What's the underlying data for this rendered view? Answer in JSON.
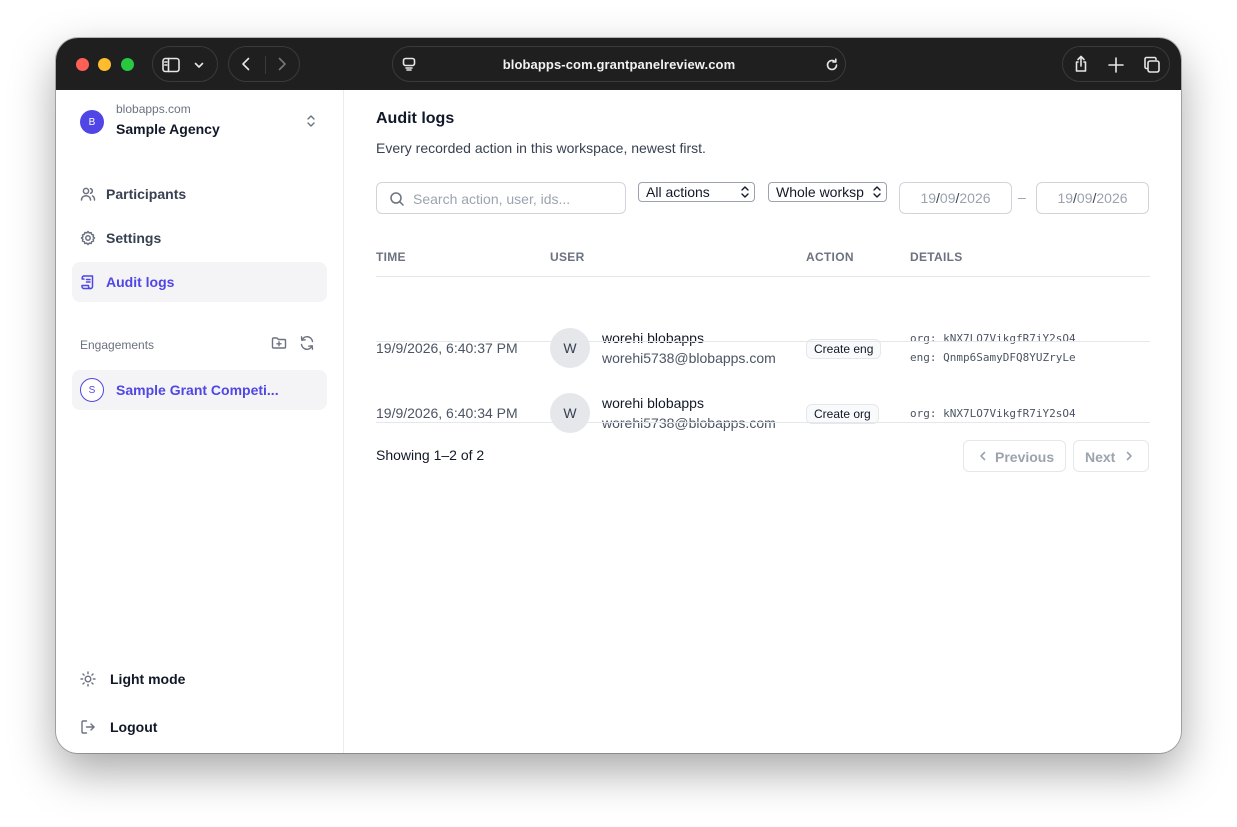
{
  "browser": {
    "url": "blobapps-com.grantpanelreview.com"
  },
  "sidebar": {
    "org": {
      "avatar_letter": "B",
      "domain": "blobapps.com",
      "name": "Sample Agency"
    },
    "nav": [
      {
        "label": "Participants",
        "icon": "users-icon",
        "active": false
      },
      {
        "label": "Settings",
        "icon": "gear-icon",
        "active": false
      },
      {
        "label": "Audit logs",
        "icon": "scroll-icon",
        "active": true
      }
    ],
    "engagements_label": "Engagements",
    "engagements": [
      {
        "avatar_letter": "S",
        "label": "Sample Grant Competi..."
      }
    ],
    "light_mode_label": "Light mode",
    "logout_label": "Logout"
  },
  "main": {
    "title": "Audit logs",
    "subtitle": "Every recorded action in this workspace, newest first.",
    "search_placeholder": "Search action, user, ids...",
    "action_filter": "All actions",
    "scope_filter": "Whole worksp",
    "date_from": {
      "day": "19",
      "month": "09",
      "year": "2026"
    },
    "date_sep": "–",
    "date_to": {
      "day": "19",
      "month": "09",
      "year": "2026"
    },
    "columns": [
      "TIME",
      "USER",
      "ACTION",
      "DETAILS"
    ],
    "rows": [
      {
        "time": "19/9/2026, 6:40:37 PM",
        "avatar_letter": "W",
        "user_name": "worehi blobapps",
        "user_email": "worehi5738@blobapps.com",
        "action": "Create eng",
        "details": [
          "org: kNX7LO7VikgfR7iY2sO4",
          "eng: Qnmp6SamyDFQ8YUZryLe"
        ]
      },
      {
        "time": "19/9/2026, 6:40:34 PM",
        "avatar_letter": "W",
        "user_name": "worehi blobapps",
        "user_email": "worehi5738@blobapps.com",
        "action": "Create org",
        "details": [
          "org: kNX7LO7VikgfR7iY2sO4"
        ]
      }
    ],
    "showing": "Showing 1–2 of 2",
    "prev_label": "Previous",
    "next_label": "Next"
  },
  "colors": {
    "accent": "#4f46e5",
    "titlebar": "#1f1f1f"
  }
}
